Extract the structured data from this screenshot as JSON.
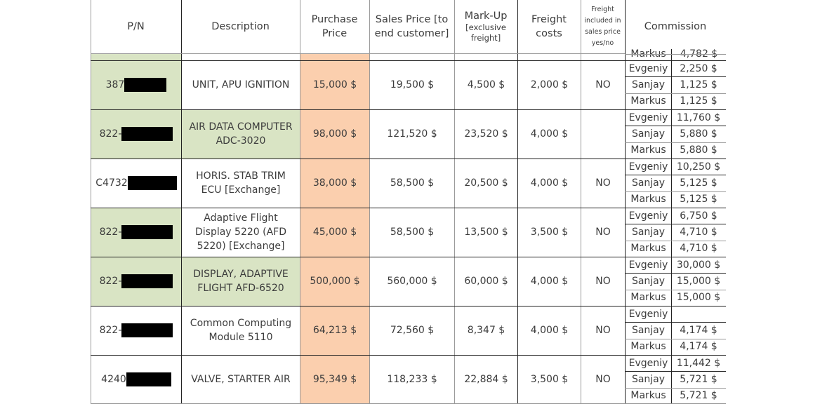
{
  "headers": {
    "pn": "P/N",
    "description": "Description",
    "purchase_price": "Purchase Price",
    "sales_price": "Sales Price [to end customer]",
    "markup": "Mark-Up [exclusive freight]",
    "freight_costs": "Freight costs",
    "freight_included": "Freight included in sales price yes/no",
    "commission": "Commission"
  },
  "partial_row": {
    "name": "Markus",
    "amount": "4,782 $"
  },
  "colors": {
    "green": "#d9e4c4",
    "peach": "#fbcfae",
    "redaction": "#000000"
  },
  "rows": [
    {
      "pn_prefix": "387",
      "pn_redacted": true,
      "description": "UNIT, APU IGNITION",
      "purchase_price": "15,000 $",
      "sales_price": "19,500 $",
      "markup": "4,500 $",
      "freight_costs": "2,000 $",
      "freight_included": "NO",
      "commission": [
        {
          "name": "Evgeniy",
          "amount": "2,250 $"
        },
        {
          "name": "Sanjay",
          "amount": "1,125 $"
        },
        {
          "name": "Markus",
          "amount": "1,125 $"
        }
      ]
    },
    {
      "pn_prefix": "822-",
      "pn_redacted": true,
      "description": "AIR DATA COMPUTER ADC-3020",
      "purchase_price": "98,000 $",
      "sales_price": "121,520 $",
      "markup": "23,520 $",
      "freight_costs": "4,000 $",
      "freight_included": "",
      "commission": [
        {
          "name": "Evgeniy",
          "amount": "11,760 $"
        },
        {
          "name": "Sanjay",
          "amount": "5,880 $"
        },
        {
          "name": "Markus",
          "amount": "5,880 $"
        }
      ]
    },
    {
      "pn_prefix": "C4732",
      "pn_redacted": true,
      "description": "HORIS. STAB TRIM ECU [Exchange]",
      "purchase_price": "38,000 $",
      "sales_price": "58,500 $",
      "markup": "20,500 $",
      "freight_costs": "4,000 $",
      "freight_included": "NO",
      "commission": [
        {
          "name": "Evgeniy",
          "amount": "10,250 $"
        },
        {
          "name": "Sanjay",
          "amount": "5,125 $"
        },
        {
          "name": "Markus",
          "amount": "5,125 $"
        }
      ]
    },
    {
      "pn_prefix": "822-",
      "pn_redacted": true,
      "description": "Adaptive Flight Display 5220 (AFD 5220) [Exchange]",
      "purchase_price": "45,000 $",
      "sales_price": "58,500 $",
      "markup": "13,500 $",
      "freight_costs": "3,500 $",
      "freight_included": "NO",
      "commission": [
        {
          "name": "Evgeniy",
          "amount": "6,750 $"
        },
        {
          "name": "Sanjay",
          "amount": "4,710 $"
        },
        {
          "name": "Markus",
          "amount": "4,710 $"
        }
      ]
    },
    {
      "pn_prefix": "822-",
      "pn_redacted": true,
      "description": "DISPLAY, ADAPTIVE FLIGHT AFD-6520",
      "purchase_price": "500,000 $",
      "sales_price": "560,000 $",
      "markup": "60,000 $",
      "freight_costs": "4,000 $",
      "freight_included": "NO",
      "commission": [
        {
          "name": "Evgeniy",
          "amount": "30,000 $"
        },
        {
          "name": "Sanjay",
          "amount": "15,000 $"
        },
        {
          "name": "Markus",
          "amount": "15,000 $"
        }
      ]
    },
    {
      "pn_prefix": "822-",
      "pn_redacted": true,
      "description": "Common Computing Module 5110",
      "purchase_price": "64,213 $",
      "sales_price": "72,560 $",
      "markup": "8,347 $",
      "freight_costs": "4,000 $",
      "freight_included": "NO",
      "commission": [
        {
          "name": "Evgeniy",
          "amount": ""
        },
        {
          "name": "Sanjay",
          "amount": "4,174 $"
        },
        {
          "name": "Markus",
          "amount": "4,174 $"
        }
      ]
    },
    {
      "pn_prefix": "4240",
      "pn_redacted": true,
      "description": "VALVE, STARTER AIR",
      "purchase_price": "95,349 $",
      "sales_price": "118,233 $",
      "markup": "22,884 $",
      "freight_costs": "3,500 $",
      "freight_included": "NO",
      "commission": [
        {
          "name": "Evgeniy",
          "amount": "11,442 $"
        },
        {
          "name": "Sanjay",
          "amount": "5,721 $"
        },
        {
          "name": "Markus",
          "amount": "5,721 $"
        }
      ]
    }
  ]
}
